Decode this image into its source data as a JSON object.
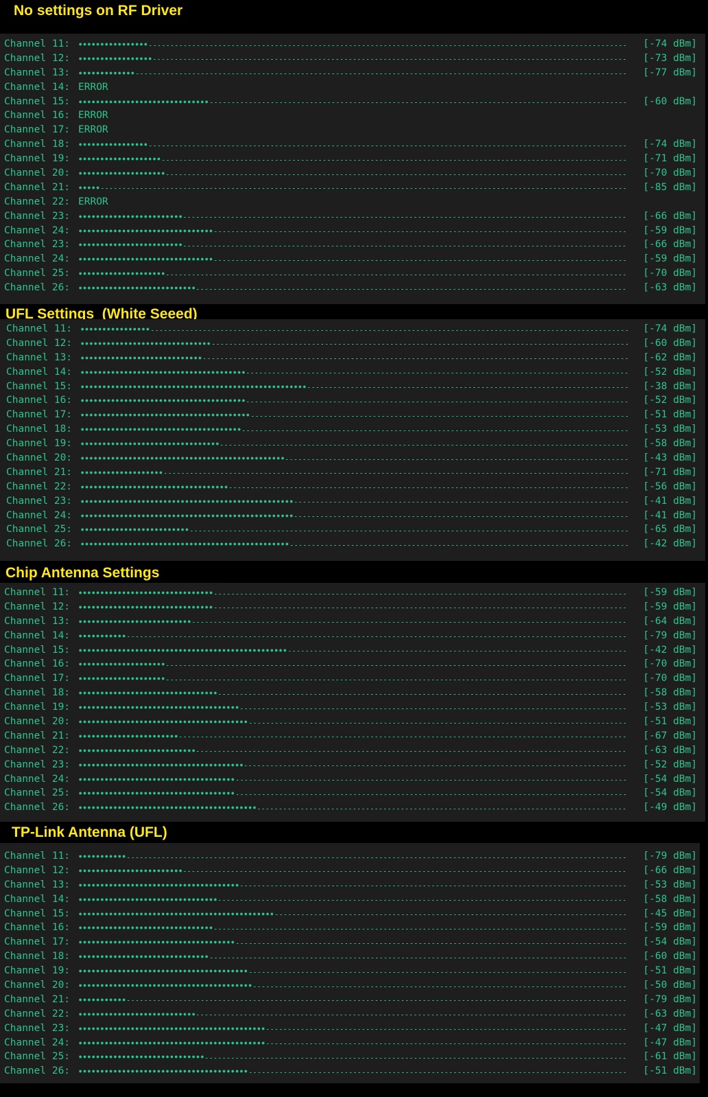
{
  "colors": {
    "background": "#000000",
    "panel": "#1e1e1e",
    "terminal_text": "#2ec58d",
    "heading": "#ffe81a"
  },
  "sections": [
    {
      "title": "No settings on RF Driver",
      "rows": [
        {
          "label": "Channel 11:",
          "value": "[-74 dBm]",
          "dots": 16
        },
        {
          "label": "Channel 12:",
          "value": "[-73 dBm]",
          "dots": 17
        },
        {
          "label": "Channel 13:",
          "value": "[-77 dBm]",
          "dots": 13
        },
        {
          "label": "Channel 14:",
          "error": "ERROR"
        },
        {
          "label": "Channel 15:",
          "value": "[-60 dBm]",
          "dots": 30
        },
        {
          "label": "Channel 16:",
          "error": "ERROR"
        },
        {
          "label": "Channel 17:",
          "error": "ERROR"
        },
        {
          "label": "Channel 18:",
          "value": "[-74 dBm]",
          "dots": 16
        },
        {
          "label": "Channel 19:",
          "value": "[-71 dBm]",
          "dots": 19
        },
        {
          "label": "Channel 20:",
          "value": "[-70 dBm]",
          "dots": 20
        },
        {
          "label": "Channel 21:",
          "value": "[-85 dBm]",
          "dots": 5
        },
        {
          "label": "Channel 22:",
          "error": "ERROR"
        },
        {
          "label": "Channel 23:",
          "value": "[-66 dBm]",
          "dots": 24
        },
        {
          "label": "Channel 24:",
          "value": "[-59 dBm]",
          "dots": 31
        },
        {
          "label": "Channel 23:",
          "value": "[-66 dBm]",
          "dots": 24
        },
        {
          "label": "Channel 24:",
          "value": "[-59 dBm]",
          "dots": 31
        },
        {
          "label": "Channel 25:",
          "value": "[-70 dBm]",
          "dots": 20
        },
        {
          "label": "Channel 26:",
          "value": "[-63 dBm]",
          "dots": 27
        }
      ]
    },
    {
      "title": "UFL Settings  (White Seeed)",
      "rows": [
        {
          "label": "Channel 11:",
          "value": "[-74 dBm]",
          "dots": 16
        },
        {
          "label": "Channel 12:",
          "value": "[-60 dBm]",
          "dots": 30
        },
        {
          "label": "Channel 13:",
          "value": "[-62 dBm]",
          "dots": 28
        },
        {
          "label": "Channel 14:",
          "value": "[-52 dBm]",
          "dots": 38
        },
        {
          "label": "Channel 15:",
          "value": "[-38 dBm]",
          "dots": 52
        },
        {
          "label": "Channel 16:",
          "value": "[-52 dBm]",
          "dots": 38
        },
        {
          "label": "Channel 17:",
          "value": "[-51 dBm]",
          "dots": 39
        },
        {
          "label": "Channel 18:",
          "value": "[-53 dBm]",
          "dots": 37
        },
        {
          "label": "Channel 19:",
          "value": "[-58 dBm]",
          "dots": 32
        },
        {
          "label": "Channel 20:",
          "value": "[-43 dBm]",
          "dots": 47
        },
        {
          "label": "Channel 21:",
          "value": "[-71 dBm]",
          "dots": 19
        },
        {
          "label": "Channel 22:",
          "value": "[-56 dBm]",
          "dots": 34
        },
        {
          "label": "Channel 23:",
          "value": "[-41 dBm]",
          "dots": 49
        },
        {
          "label": "Channel 24:",
          "value": "[-41 dBm]",
          "dots": 49
        },
        {
          "label": "Channel 25:",
          "value": "[-65 dBm]",
          "dots": 25
        },
        {
          "label": "Channel 26:",
          "value": "[-42 dBm]",
          "dots": 48
        }
      ]
    },
    {
      "title": "Chip Antenna Settings",
      "rows": [
        {
          "label": "Channel 11:",
          "value": "[-59 dBm]",
          "dots": 31
        },
        {
          "label": "Channel 12:",
          "value": "[-59 dBm]",
          "dots": 31
        },
        {
          "label": "Channel 13:",
          "value": "[-64 dBm]",
          "dots": 26
        },
        {
          "label": "Channel 14:",
          "value": "[-79 dBm]",
          "dots": 11
        },
        {
          "label": "Channel 15:",
          "value": "[-42 dBm]",
          "dots": 48
        },
        {
          "label": "Channel 16:",
          "value": "[-70 dBm]",
          "dots": 20
        },
        {
          "label": "Channel 17:",
          "value": "[-70 dBm]",
          "dots": 20
        },
        {
          "label": "Channel 18:",
          "value": "[-58 dBm]",
          "dots": 32
        },
        {
          "label": "Channel 19:",
          "value": "[-53 dBm]",
          "dots": 37
        },
        {
          "label": "Channel 20:",
          "value": "[-51 dBm]",
          "dots": 39
        },
        {
          "label": "Channel 21:",
          "value": "[-67 dBm]",
          "dots": 23
        },
        {
          "label": "Channel 22:",
          "value": "[-63 dBm]",
          "dots": 27
        },
        {
          "label": "Channel 23:",
          "value": "[-52 dBm]",
          "dots": 38
        },
        {
          "label": "Channel 24:",
          "value": "[-54 dBm]",
          "dots": 36
        },
        {
          "label": "Channel 25:",
          "value": "[-54 dBm]",
          "dots": 36
        },
        {
          "label": "Channel 26:",
          "value": "[-49 dBm]",
          "dots": 41
        }
      ]
    },
    {
      "title": "TP-Link Antenna (UFL)",
      "rows": [
        {
          "label": "Channel 11:",
          "value": "[-79 dBm]",
          "dots": 11
        },
        {
          "label": "Channel 12:",
          "value": "[-66 dBm]",
          "dots": 24
        },
        {
          "label": "Channel 13:",
          "value": "[-53 dBm]",
          "dots": 37
        },
        {
          "label": "Channel 14:",
          "value": "[-58 dBm]",
          "dots": 32
        },
        {
          "label": "Channel 15:",
          "value": "[-45 dBm]",
          "dots": 45
        },
        {
          "label": "Channel 16:",
          "value": "[-59 dBm]",
          "dots": 31
        },
        {
          "label": "Channel 17:",
          "value": "[-54 dBm]",
          "dots": 36
        },
        {
          "label": "Channel 18:",
          "value": "[-60 dBm]",
          "dots": 30
        },
        {
          "label": "Channel 19:",
          "value": "[-51 dBm]",
          "dots": 39
        },
        {
          "label": "Channel 20:",
          "value": "[-50 dBm]",
          "dots": 40
        },
        {
          "label": "Channel 21:",
          "value": "[-79 dBm]",
          "dots": 11
        },
        {
          "label": "Channel 22:",
          "value": "[-63 dBm]",
          "dots": 27
        },
        {
          "label": "Channel 23:",
          "value": "[-47 dBm]",
          "dots": 43
        },
        {
          "label": "Channel 24:",
          "value": "[-47 dBm]",
          "dots": 43
        },
        {
          "label": "Channel 25:",
          "value": "[-61 dBm]",
          "dots": 29
        },
        {
          "label": "Channel 26:",
          "value": "[-51 dBm]",
          "dots": 39
        }
      ]
    }
  ]
}
